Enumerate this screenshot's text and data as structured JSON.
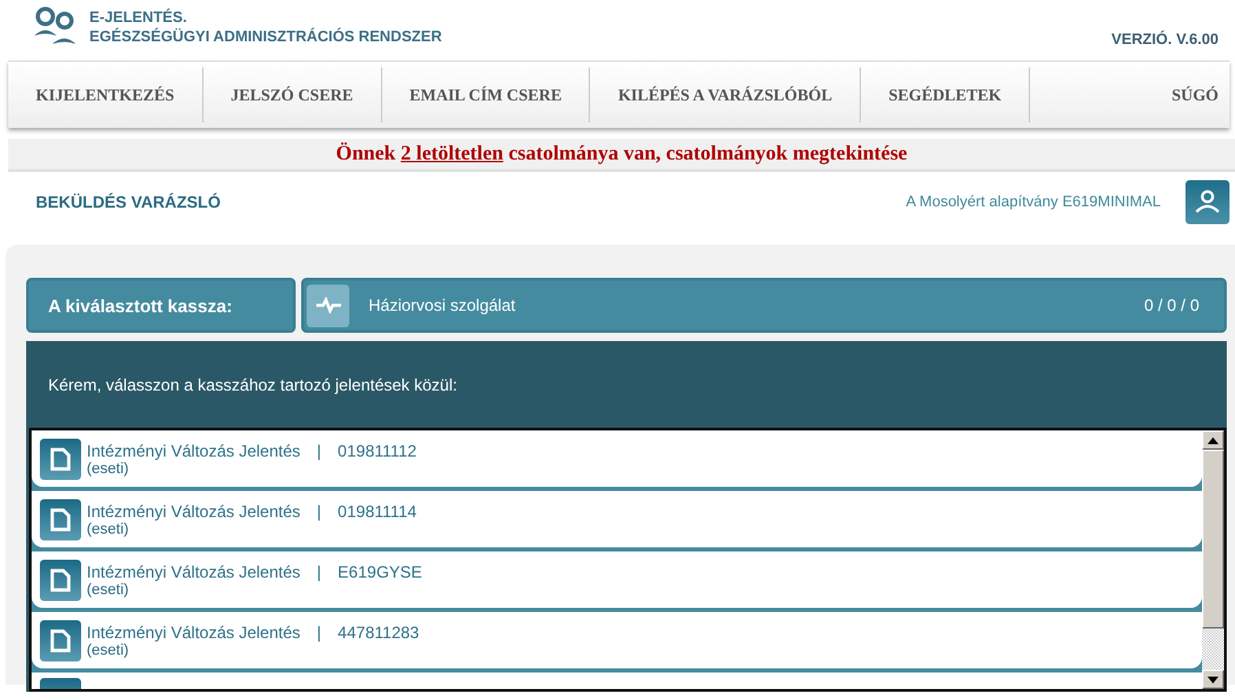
{
  "header": {
    "title": "E-JELENTÉS.",
    "subtitle": "EGÉSZSÉGÜGYI ADMINISZTRÁCIÓS RENDSZER",
    "version": "VERZIÓ. V.6.00"
  },
  "nav": [
    {
      "label": "KIJELENTKEZÉS"
    },
    {
      "label": "JELSZÓ CSERE"
    },
    {
      "label": "EMAIL CÍM CSERE"
    },
    {
      "label": "KILÉPÉS A VARÁZSLÓBÓL"
    },
    {
      "label": "SEGÉDLETEK"
    }
  ],
  "nav_right": "SÚGÓ",
  "notice": {
    "before": "Önnek ",
    "link": "2 letöltetlen",
    "after": " csatolmánya van, csatolmányok megtekintése"
  },
  "subheader": {
    "title": "BEKÜLDÉS VARÁZSLÓ",
    "organization": "A Mosolyért alapítvány E619MINIMAL"
  },
  "kassza": {
    "label": "A kiválasztott kassza:",
    "name": "Háziorvosi szolgálat",
    "counts": "0 / 0 / 0"
  },
  "prompt": "Kérem, válasszon a kasszához tartozó jelentések közül:",
  "reports": [
    {
      "title": "Intézményi Változás Jelentés",
      "separator": "|",
      "code": "019811112",
      "type": "(eseti)"
    },
    {
      "title": "Intézményi Változás Jelentés",
      "separator": "|",
      "code": "019811114",
      "type": "(eseti)"
    },
    {
      "title": "Intézményi Változás Jelentés",
      "separator": "|",
      "code": "E619GYSE",
      "type": "(eseti)"
    },
    {
      "title": "Intézményi Változás Jelentés",
      "separator": "|",
      "code": "447811283",
      "type": "(eseti)"
    }
  ]
}
